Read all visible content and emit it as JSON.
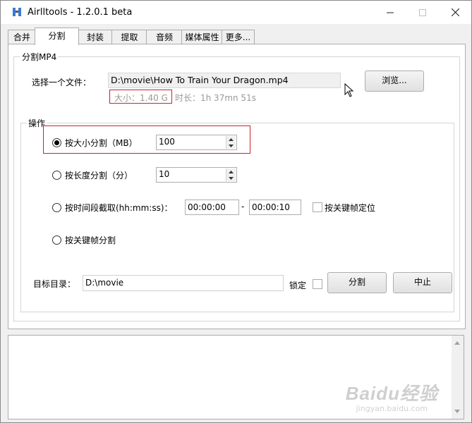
{
  "window": {
    "title": "Airlltools  -  1.2.0.1 beta"
  },
  "tabs": [
    {
      "label": "合并",
      "active": false
    },
    {
      "label": "分割",
      "active": true
    },
    {
      "label": "封装",
      "active": false
    },
    {
      "label": "提取",
      "active": false
    },
    {
      "label": "音频",
      "active": false
    },
    {
      "label": "媒体属性",
      "active": false
    },
    {
      "label": "更多...",
      "active": false
    }
  ],
  "split_group": {
    "title": "分割MP4",
    "file_label": "选择一个文件：",
    "file_path": "D:\\movie\\How To Train Your Dragon.mp4",
    "size_text": "大小：1.40 G",
    "duration_text": "时长：1h 37mn 51s",
    "browse_label": "浏览..."
  },
  "ops_group": {
    "title": "操作",
    "by_size": {
      "label": "按大小分割（MB）",
      "value": "100",
      "selected": true
    },
    "by_duration": {
      "label": "按长度分割（分）",
      "value": "10",
      "selected": false
    },
    "by_time_range": {
      "label": "按时间段截取(hh:mm:ss)：",
      "start": "00:00:00",
      "separator": "-",
      "end": "00:00:10",
      "selected": false,
      "keyframe_label": "按关键帧定位"
    },
    "by_keyframe": {
      "label": "按关键帧分割",
      "selected": false
    }
  },
  "target": {
    "label": "目标目录：",
    "path": "D:\\movie",
    "lock_label": "锁定",
    "split_button": "分割",
    "stop_button": "中止"
  },
  "log": {
    "content": ""
  },
  "watermark": {
    "main": "Baidu经验",
    "sub": "jingyan.baidu.com"
  },
  "colors": {
    "highlight_box": "#c8232c",
    "window_bg": "#f0f0f0",
    "panel_bg": "#ffffff"
  }
}
